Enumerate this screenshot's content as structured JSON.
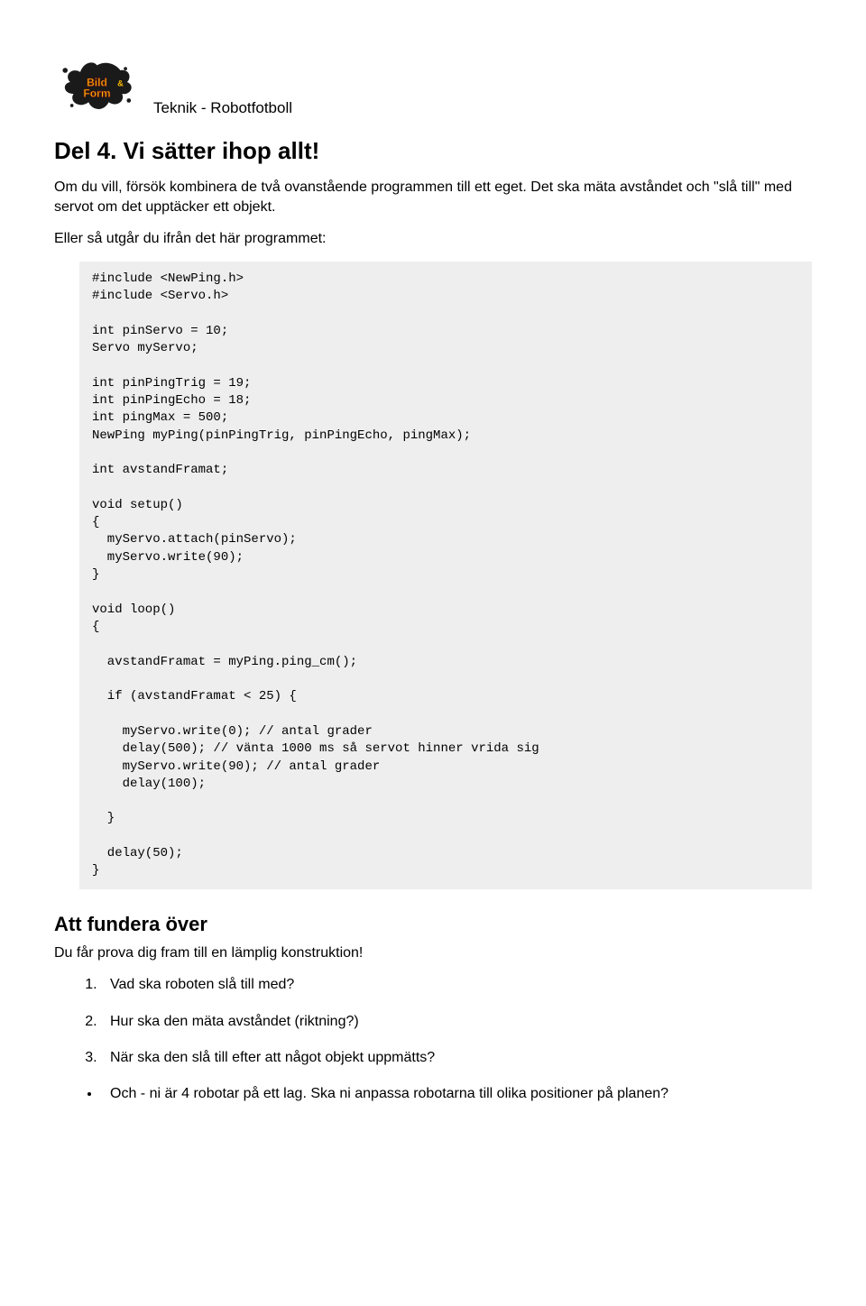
{
  "header": {
    "subject": "Teknik - Robotfotboll"
  },
  "title": "Del 4. Vi sätter ihop allt!",
  "intro1": "Om du vill, försök kombinera de två ovanstående programmen till ett eget. Det ska mäta avståndet och \"slå till\" med servot om det upptäcker ett objekt.",
  "intro2": "Eller så utgår du ifrån det här programmet:",
  "code": "#include <NewPing.h>\n#include <Servo.h>\n\nint pinServo = 10;\nServo myServo;\n\nint pinPingTrig = 19;\nint pinPingEcho = 18;\nint pingMax = 500;\nNewPing myPing(pinPingTrig, pinPingEcho, pingMax);\n\nint avstandFramat;\n\nvoid setup()\n{\n  myServo.attach(pinServo);\n  myServo.write(90);\n}\n\nvoid loop()\n{\n\n  avstandFramat = myPing.ping_cm();\n\n  if (avstandFramat < 25) {\n\n    myServo.write(0); // antal grader\n    delay(500); // vänta 1000 ms så servot hinner vrida sig\n    myServo.write(90); // antal grader\n    delay(100);\n\n  }\n\n  delay(50);\n}",
  "section2_title": "Att fundera över",
  "section2_intro": "Du får prova dig fram till en lämplig konstruktion!",
  "questions": [
    "Vad ska roboten slå till med?",
    "Hur ska den mäta avståndet (riktning?)",
    "När ska den slå till efter att något objekt uppmätts?"
  ],
  "bullet": "Och - ni är 4 robotar på ett lag. Ska ni anpassa robotarna till olika positioner på planen?",
  "logo": {
    "brand_top": "Bild",
    "brand_amp": "&",
    "brand_bottom": "Form"
  }
}
